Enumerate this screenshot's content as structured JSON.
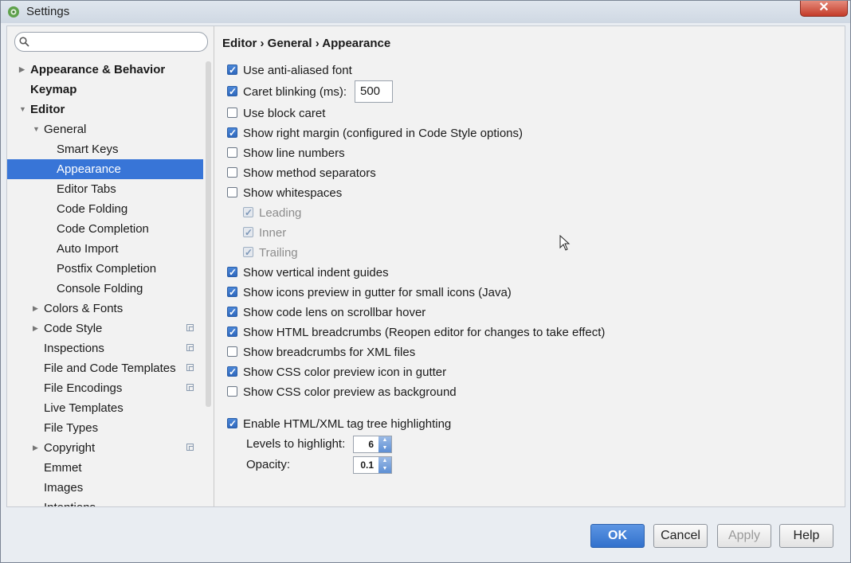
{
  "window": {
    "title": "Settings",
    "close_label": "✕"
  },
  "search": {
    "placeholder": ""
  },
  "tree": [
    {
      "label": "Appearance & Behavior",
      "level": 0,
      "arrow": "right",
      "bold": true
    },
    {
      "label": "Keymap",
      "level": 0,
      "arrow": "",
      "bold": true
    },
    {
      "label": "Editor",
      "level": 0,
      "arrow": "down",
      "bold": true
    },
    {
      "label": "General",
      "level": 1,
      "arrow": "down"
    },
    {
      "label": "Smart Keys",
      "level": 2,
      "arrow": ""
    },
    {
      "label": "Appearance",
      "level": 2,
      "arrow": "",
      "selected": true
    },
    {
      "label": "Editor Tabs",
      "level": 2,
      "arrow": ""
    },
    {
      "label": "Code Folding",
      "level": 2,
      "arrow": ""
    },
    {
      "label": "Code Completion",
      "level": 2,
      "arrow": ""
    },
    {
      "label": "Auto Import",
      "level": 2,
      "arrow": ""
    },
    {
      "label": "Postfix Completion",
      "level": 2,
      "arrow": ""
    },
    {
      "label": "Console Folding",
      "level": 2,
      "arrow": ""
    },
    {
      "label": "Colors & Fonts",
      "level": 1,
      "arrow": "right"
    },
    {
      "label": "Code Style",
      "level": 1,
      "arrow": "right",
      "copy_icon": true
    },
    {
      "label": "Inspections",
      "level": 1,
      "arrow": "",
      "copy_icon": true
    },
    {
      "label": "File and Code Templates",
      "level": 1,
      "arrow": "",
      "copy_icon": true
    },
    {
      "label": "File Encodings",
      "level": 1,
      "arrow": "",
      "copy_icon": true
    },
    {
      "label": "Live Templates",
      "level": 1,
      "arrow": ""
    },
    {
      "label": "File Types",
      "level": 1,
      "arrow": ""
    },
    {
      "label": "Copyright",
      "level": 1,
      "arrow": "right",
      "copy_icon": true
    },
    {
      "label": "Emmet",
      "level": 1,
      "arrow": ""
    },
    {
      "label": "Images",
      "level": 1,
      "arrow": ""
    },
    {
      "label": "Intentions",
      "level": 1,
      "arrow": ""
    }
  ],
  "breadcrumb": "Editor › General › Appearance",
  "options": {
    "anti_aliased": {
      "label": "Use anti-aliased font",
      "checked": true
    },
    "caret_blinking": {
      "label": "Caret blinking (ms):",
      "checked": true,
      "value": "500"
    },
    "block_caret": {
      "label": "Use block caret",
      "checked": false
    },
    "right_margin": {
      "label": "Show right margin (configured in Code Style options)",
      "checked": true
    },
    "line_numbers": {
      "label": "Show line numbers",
      "checked": false
    },
    "method_separators": {
      "label": "Show method separators",
      "checked": false
    },
    "whitespaces": {
      "label": "Show whitespaces",
      "checked": false
    },
    "leading": {
      "label": "Leading",
      "checked": true,
      "disabled": true
    },
    "inner": {
      "label": "Inner",
      "checked": true,
      "disabled": true
    },
    "trailing": {
      "label": "Trailing",
      "checked": true,
      "disabled": true
    },
    "indent_guides": {
      "label": "Show vertical indent guides",
      "checked": true
    },
    "icons_preview": {
      "label": "Show icons preview in gutter for small icons (Java)",
      "checked": true
    },
    "code_lens": {
      "label": "Show code lens on scrollbar hover",
      "checked": true
    },
    "html_breadcrumbs": {
      "label": "Show HTML breadcrumbs (Reopen editor for changes to take effect)",
      "checked": true
    },
    "xml_breadcrumbs": {
      "label": "Show breadcrumbs for XML files",
      "checked": false
    },
    "css_color_icon": {
      "label": "Show CSS color preview icon in gutter",
      "checked": true
    },
    "css_color_bg": {
      "label": "Show CSS color preview as background",
      "checked": false
    },
    "tag_tree": {
      "label": "Enable HTML/XML tag tree highlighting",
      "checked": true
    }
  },
  "levels": {
    "label": "Levels to highlight:",
    "value": "6"
  },
  "opacity": {
    "label": "Opacity:",
    "value": "0.1"
  },
  "buttons": {
    "ok": "OK",
    "cancel": "Cancel",
    "apply": "Apply",
    "help": "Help"
  },
  "colors": {
    "accent": "#3875d7",
    "close": "#c43c2a"
  }
}
